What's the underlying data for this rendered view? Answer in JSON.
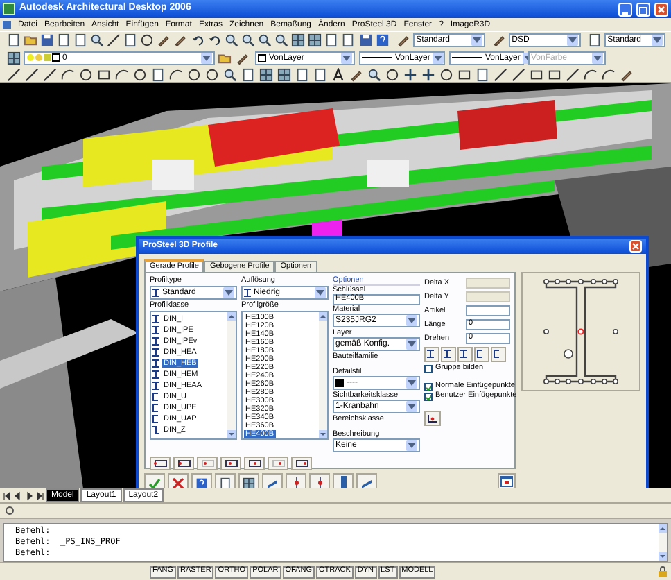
{
  "window": {
    "title": "Autodesk Architectural Desktop 2006"
  },
  "menu": [
    "Datei",
    "Bearbeiten",
    "Ansicht",
    "Einfügen",
    "Format",
    "Extras",
    "Zeichnen",
    "Bemaßung",
    "Ändern",
    "ProSteel 3D",
    "Fenster",
    "?",
    "ImageR3D"
  ],
  "style_combos": [
    "Standard",
    "DSD",
    "Standard"
  ],
  "layer_combo": {
    "value": "0"
  },
  "property_combos": [
    {
      "value": "VonLayer",
      "kind": "color",
      "disabled": false
    },
    {
      "value": "VonLayer",
      "kind": "linetype",
      "disabled": false
    },
    {
      "value": "VonLayer",
      "kind": "linetype",
      "disabled": false
    },
    {
      "value": "VonFarbe",
      "kind": "plain",
      "disabled": true
    }
  ],
  "dialog": {
    "title": "ProSteel 3D Profile",
    "tabs": [
      {
        "label": "Gerade Profile",
        "selected": true
      },
      {
        "label": "Gebogene Profile",
        "selected": false
      },
      {
        "label": "Optionen",
        "selected": false
      }
    ],
    "profiltype": {
      "label": "Profiltype",
      "value": "Standard"
    },
    "aufloesung": {
      "label": "Auflösung",
      "value": "Niedrig"
    },
    "profilklasse": {
      "label": "Profilklasse",
      "items": [
        {
          "label": "DIN_I",
          "kind": "i",
          "selected": false
        },
        {
          "label": "DIN_IPE",
          "kind": "i",
          "selected": false
        },
        {
          "label": "DIN_IPEv",
          "kind": "i",
          "selected": false
        },
        {
          "label": "DIN_HEA",
          "kind": "i",
          "selected": false
        },
        {
          "label": "DIN_HEB",
          "kind": "i",
          "selected": true
        },
        {
          "label": "DIN_HEM",
          "kind": "i",
          "selected": false
        },
        {
          "label": "DIN_HEAA",
          "kind": "i",
          "selected": false
        },
        {
          "label": "DIN_U",
          "kind": "u",
          "selected": false
        },
        {
          "label": "DIN_UPE",
          "kind": "u",
          "selected": false
        },
        {
          "label": "DIN_UAP",
          "kind": "u",
          "selected": false
        },
        {
          "label": "DIN_Z",
          "kind": "z",
          "selected": false
        }
      ]
    },
    "profilgroesse": {
      "label": "Profilgröße",
      "items": [
        {
          "label": "HE100B",
          "selected": false
        },
        {
          "label": "HE120B",
          "selected": false
        },
        {
          "label": "HE140B",
          "selected": false
        },
        {
          "label": "HE160B",
          "selected": false
        },
        {
          "label": "HE180B",
          "selected": false
        },
        {
          "label": "HE200B",
          "selected": false
        },
        {
          "label": "HE220B",
          "selected": false
        },
        {
          "label": "HE240B",
          "selected": false
        },
        {
          "label": "HE260B",
          "selected": false
        },
        {
          "label": "HE280B",
          "selected": false
        },
        {
          "label": "HE300B",
          "selected": false
        },
        {
          "label": "HE320B",
          "selected": false
        },
        {
          "label": "HE340B",
          "selected": false
        },
        {
          "label": "HE360B",
          "selected": false
        },
        {
          "label": "HE400B",
          "selected": true
        }
      ]
    },
    "optionen": {
      "title": "Optionen",
      "fields": [
        {
          "label": "Schlüssel",
          "kind": "text",
          "value": "HE400B"
        },
        {
          "label": "Material",
          "kind": "combo",
          "value": "S235JRG2"
        },
        {
          "label": "Layer",
          "kind": "combo",
          "value": "gemäß Konfig."
        },
        {
          "label": "Bauteilfamilie",
          "kind": "label"
        },
        {
          "label": "Detailstil",
          "kind": "swatch",
          "value": "----"
        },
        {
          "label": "Sichtbarkeitsklasse",
          "kind": "combo",
          "value": "1-Kranbahn"
        },
        {
          "label": "Bereichsklasse",
          "kind": "label"
        },
        {
          "label": "Beschreibung",
          "kind": "combo",
          "value": "Keine"
        }
      ]
    },
    "placement": [
      {
        "label": "Delta X",
        "disabled": true
      },
      {
        "label": "Delta Y",
        "disabled": true
      },
      {
        "label": "Artikel",
        "disabled": false
      },
      {
        "label": "Länge",
        "value": "0",
        "disabled": false
      },
      {
        "label": "Drehen",
        "value": "0",
        "disabled": false
      }
    ],
    "checkboxes": [
      {
        "label": "Gruppe bilden",
        "checked": false
      },
      {
        "label": "Normale Einfügepunkte",
        "checked": true
      },
      {
        "label": "Benutzer Einfügepunkte",
        "checked": true
      }
    ]
  },
  "layout_tabs": [
    {
      "label": "Model",
      "selected": true
    },
    {
      "label": "Layout1",
      "selected": false
    },
    {
      "label": "Layout2",
      "selected": false
    }
  ],
  "command_lines": [
    "Befehl:",
    "Befehl:  _PS_INS_PROF",
    "Befehl:"
  ],
  "status_toggles": [
    "FANG",
    "RASTER",
    "ORTHO",
    "POLAR",
    "OFANG",
    "OTRACK",
    "DYN",
    "LST",
    "MODELL"
  ]
}
